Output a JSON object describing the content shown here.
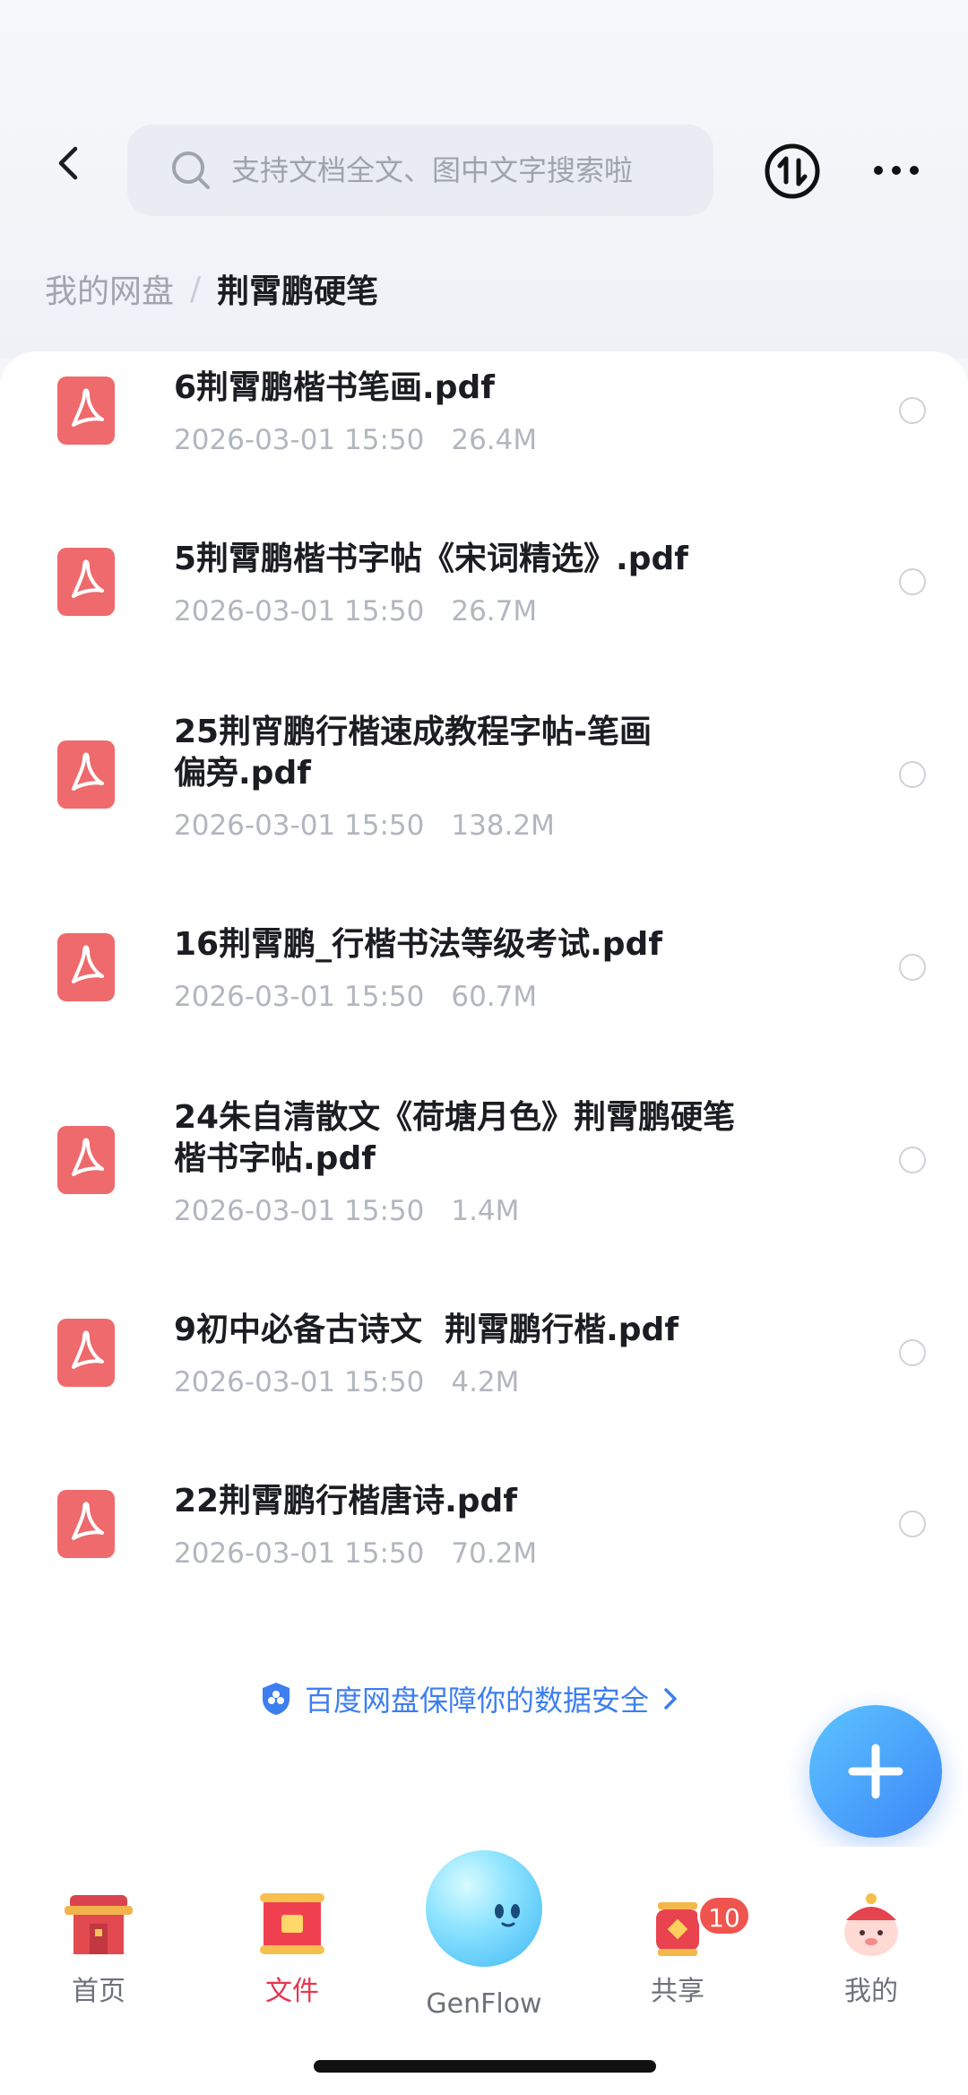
{
  "search": {
    "placeholder": "支持文档全文、图中文字搜索啦"
  },
  "breadcrumb": {
    "root": "我的网盘",
    "separator": "/",
    "current": "荆霄鹏硬笔"
  },
  "files": [
    {
      "name": "6荆霄鹏楷书笔画.pdf",
      "date": "2026-03-01 15:50",
      "size": "26.4M"
    },
    {
      "name": "5荆霄鹏楷书字帖《宋词精选》.pdf",
      "date": "2026-03-01 15:50",
      "size": "26.7M"
    },
    {
      "name_line1": "25荆宵鹏行楷速成教程字帖-笔画",
      "name_line2": "偏旁.pdf",
      "date": "2026-03-01 15:50",
      "size": "138.2M"
    },
    {
      "name": "16荆霄鹏_行楷书法等级考试.pdf",
      "date": "2026-03-01 15:50",
      "size": "60.7M"
    },
    {
      "name_line1": "24朱自清散文《荷塘月色》荆霄鹏硬笔",
      "name_line2": "楷书字帖.pdf",
      "date": "2026-03-01 15:50",
      "size": "1.4M"
    },
    {
      "name": "9初中必备古诗文  荆霄鹏行楷.pdf",
      "date": "2026-03-01 15:50",
      "size": "4.2M"
    },
    {
      "name": "22荆霄鹏行楷唐诗.pdf",
      "date": "2026-03-01 15:50",
      "size": "70.2M"
    }
  ],
  "safety_notice": "百度网盘保障你的数据安全",
  "tabs": {
    "home": "首页",
    "files": "文件",
    "genflow": "GenFlow",
    "share": "共享",
    "share_badge": "10",
    "mine": "我的"
  },
  "colors": {
    "accent": "#3d7ef0",
    "pdf_icon": "#ee6a6c",
    "active_tab": "#e8344f",
    "badge": "#f0544f"
  }
}
